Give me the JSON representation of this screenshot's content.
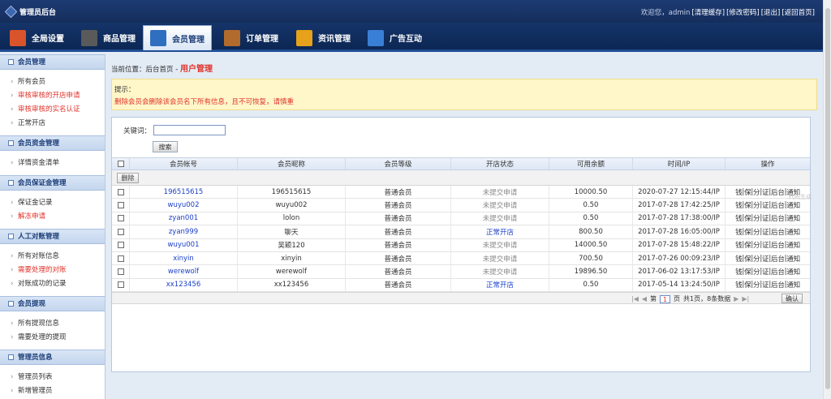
{
  "header": {
    "title": "管理员后台",
    "links": [
      "欢迎您，admin",
      "[清理缓存]",
      "[修改密码]",
      "[退出]",
      "[返回首页]"
    ]
  },
  "nav": [
    {
      "label": "全局设置",
      "icon": "settings-icon",
      "color": "#d9542b"
    },
    {
      "label": "商品管理",
      "icon": "grid-icon",
      "color": "#5a5a5a"
    },
    {
      "label": "会员管理",
      "icon": "member-icon",
      "color": "#2f6fbf",
      "active": true
    },
    {
      "label": "订单管理",
      "icon": "order-icon",
      "color": "#b36b2d"
    },
    {
      "label": "资讯管理",
      "icon": "news-icon",
      "color": "#e5a21a"
    },
    {
      "label": "广告互动",
      "icon": "ad-icon",
      "color": "#3a7fd6"
    }
  ],
  "sidebar": [
    {
      "title": "会员管理",
      "items": [
        {
          "label": "所有会员",
          "red": false
        },
        {
          "label": "审核审核的开店申请",
          "red": true
        },
        {
          "label": "审核审核的实名认证",
          "red": true
        },
        {
          "label": "正常开店",
          "red": false
        }
      ]
    },
    {
      "title": "会员资金管理",
      "items": [
        {
          "label": "详情资金清单",
          "red": false
        }
      ]
    },
    {
      "title": "会员保证金管理",
      "items": [
        {
          "label": "保证金记录",
          "red": false
        },
        {
          "label": "解冻申请",
          "red": true
        }
      ]
    },
    {
      "title": "人工对账管理",
      "items": [
        {
          "label": "所有对账信息",
          "red": false
        },
        {
          "label": "需要处理的对账",
          "red": true
        },
        {
          "label": "对账成功的记录",
          "red": false
        }
      ]
    },
    {
      "title": "会员提现",
      "items": [
        {
          "label": "所有提现信息",
          "red": false
        },
        {
          "label": "需要处理的提现",
          "red": false
        }
      ]
    },
    {
      "title": "管理员信息",
      "items": [
        {
          "label": "管理员列表",
          "red": false
        },
        {
          "label": "新增管理员",
          "red": false
        }
      ]
    }
  ],
  "crumb": {
    "prefix": "当前位置：后台首页 - ",
    "current": "用户管理"
  },
  "tip": {
    "title": "提示：",
    "text": "删除会员会删除该会员名下所有信息，且不可恢复，请慎重"
  },
  "search": {
    "label": "关键词：",
    "value": "",
    "button": "搜索"
  },
  "table": {
    "headers": [
      "",
      "会员帐号",
      "会员昵称",
      "会员等级",
      "开店状态",
      "可用余额",
      "时间/IP",
      "操作"
    ],
    "delete_button": "删除",
    "rows": [
      {
        "account": "196515615",
        "nickname": "196515615",
        "level": "普通会员",
        "status": "未提交申请",
        "status_ok": false,
        "balance": "10000.50",
        "time": "2020-07-27 12:15:44/IP"
      },
      {
        "account": "wuyu002",
        "nickname": "wuyu002",
        "level": "普通会员",
        "status": "未提交申请",
        "status_ok": false,
        "balance": "0.50",
        "time": "2017-07-28 17:42:25/IP"
      },
      {
        "account": "zyan001",
        "nickname": "lolon",
        "level": "普通会员",
        "status": "未提交申请",
        "status_ok": false,
        "balance": "0.50",
        "time": "2017-07-28 17:38:00/IP"
      },
      {
        "account": "zyan999",
        "nickname": "聊天",
        "level": "普通会员",
        "status": "正常开店",
        "status_ok": true,
        "balance": "800.50",
        "time": "2017-07-28 16:05:00/IP"
      },
      {
        "account": "wuyu001",
        "nickname": "吴颖120",
        "level": "普通会员",
        "status": "未提交申请",
        "status_ok": false,
        "balance": "14000.50",
        "time": "2017-07-28 15:48:22/IP"
      },
      {
        "account": "xinyin",
        "nickname": "xinyin",
        "level": "普通会员",
        "status": "未提交申请",
        "status_ok": false,
        "balance": "700.50",
        "time": "2017-07-26 00:09:23/IP"
      },
      {
        "account": "werewolf",
        "nickname": "werewolf",
        "level": "普通会员",
        "status": "未提交申请",
        "status_ok": false,
        "balance": "19896.50",
        "time": "2017-06-02 13:17:53/IP"
      },
      {
        "account": "xx123456",
        "nickname": "xx123456",
        "level": "普通会员",
        "status": "正常开店",
        "status_ok": true,
        "balance": "0.50",
        "time": "2017-05-14 13:24:50/IP"
      }
    ],
    "ops": [
      "钱",
      "保",
      "分",
      "证",
      "后台",
      "通知"
    ]
  },
  "pager": {
    "first": "|◀",
    "prev": "◀",
    "page_prefix": "第",
    "page": "1",
    "page_suffix": "页",
    "summary": "共1页，8条数据",
    "next": "▶",
    "last": "▶|",
    "ok": "确认"
  },
  "watermark": "代码生成"
}
